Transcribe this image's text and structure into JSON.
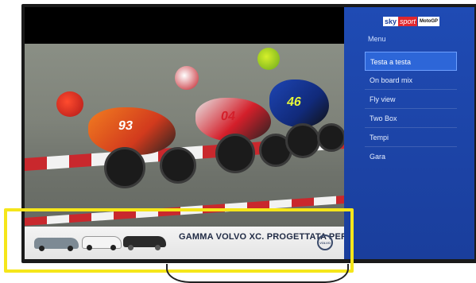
{
  "sidebar": {
    "brand": {
      "sky": "sky",
      "sport": "sport",
      "logo": "MotoGP"
    },
    "menu_title": "Menu",
    "items": [
      {
        "label": "Testa a testa",
        "active": true
      },
      {
        "label": "On board mix",
        "active": false
      },
      {
        "label": "Fly view",
        "active": false
      },
      {
        "label": "Two Box",
        "active": false
      },
      {
        "label": "Tempi",
        "active": false
      },
      {
        "label": "Gara",
        "active": false
      }
    ]
  },
  "video": {
    "riders": [
      {
        "number": "93"
      },
      {
        "number": "04"
      },
      {
        "number": "46"
      }
    ]
  },
  "ad": {
    "headline": "GAMMA VOLVO XC. PROGETTATA PER TE.",
    "brand": "VOLVO"
  },
  "colors": {
    "sidebar": "#1a3e9c",
    "active_item": "#2d66d8",
    "highlight": "#f5e61a",
    "kerb_red": "#c9282d"
  }
}
